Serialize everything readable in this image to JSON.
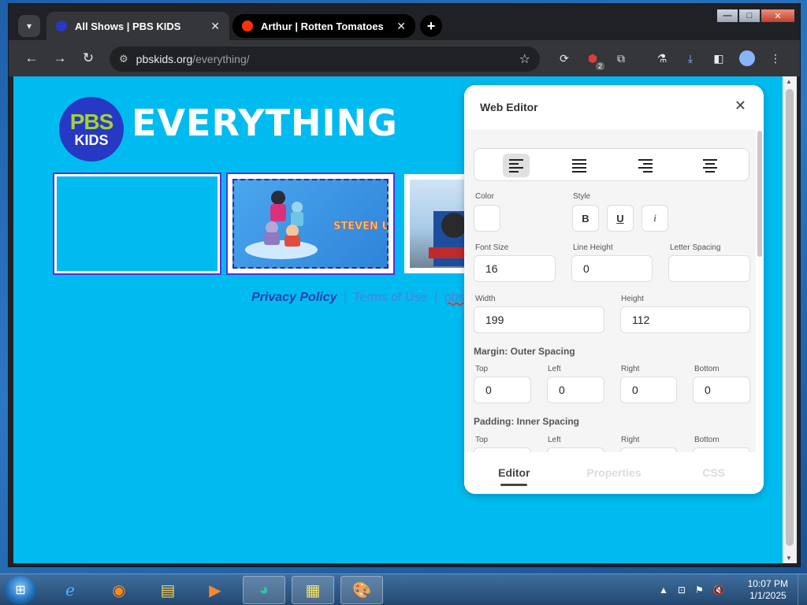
{
  "browser": {
    "tabs": [
      {
        "title": "All Shows | PBS KIDS",
        "active": true,
        "favicon_color": "#2638c4"
      },
      {
        "title": "Arthur | Rotten Tomatoes",
        "active": false,
        "favicon_color": "#fa320a"
      }
    ],
    "tab_close": "✕",
    "new_tab": "+",
    "url_host": "pbskids.org",
    "url_path": "/everything/",
    "extension_badge": "2",
    "window_controls": {
      "minimize": "—",
      "maximize": "□",
      "close": "✕"
    }
  },
  "page": {
    "background": "#00bbf0",
    "logo_pbs": "PBS",
    "logo_kids": "KIDS",
    "heading": "EVERYTHING",
    "show_art_title": "STEVEN UNIVERSE",
    "footer": {
      "privacy": "Privacy Policy",
      "separator": "|",
      "terms": "Terms of Use",
      "more": "pbskid"
    }
  },
  "editor": {
    "title": "Web Editor",
    "close": "✕",
    "labels": {
      "color": "Color",
      "style": "Style",
      "font_size": "Font Size",
      "line_height": "Line Height",
      "letter_spacing": "Letter Spacing",
      "width": "Width",
      "height": "Height",
      "margin_section": "Margin: Outer Spacing",
      "padding_section": "Padding: Inner Spacing",
      "top": "Top",
      "left": "Left",
      "right": "Right",
      "bottom": "Bottom"
    },
    "values": {
      "font_size": "16",
      "line_height": "0",
      "letter_spacing": "",
      "width": "199",
      "height": "112",
      "margin_top": "0",
      "margin_left": "0",
      "margin_right": "0",
      "margin_bottom": "0"
    },
    "style_buttons": {
      "bold": "B",
      "underline": "U",
      "italic": "i"
    },
    "tabs": [
      "Editor",
      "Properties",
      "CSS"
    ],
    "active_tab": "Editor"
  },
  "taskbar": {
    "time": "10:07 PM",
    "date": "1/1/2025"
  }
}
